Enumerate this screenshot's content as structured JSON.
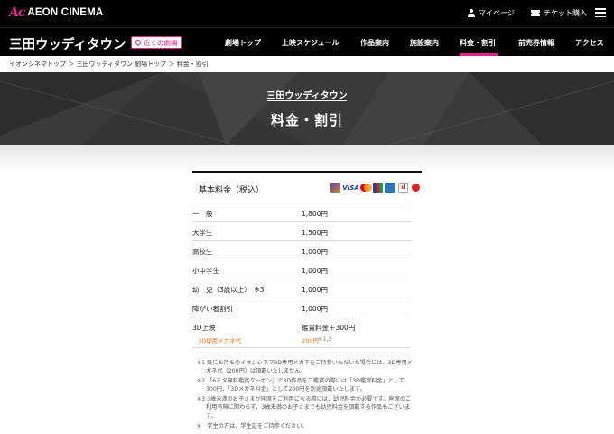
{
  "brand": {
    "mark": "Ac",
    "name": "AEON CINEMA"
  },
  "header": {
    "my_page": "マイページ",
    "ticket": "チケット購入"
  },
  "nav": {
    "theater_name": "三田ウッディタウン",
    "nearby_label": "近くの劇場",
    "items": [
      "劇場トップ",
      "上映スケジュール",
      "作品案内",
      "施設案内",
      "料金・割引",
      "前売券情報",
      "アクセス"
    ],
    "active_index": 4
  },
  "breadcrumb": "イオンシネマトップ ＞ 三田ウッディタウン 劇場トップ ＞ 料金・割引",
  "hero": {
    "subtitle": "三田ウッディタウン",
    "title": "料金・割引"
  },
  "pricing": {
    "heading": "基本料金（税込）",
    "payment_labels": {
      "visa": "VISA",
      "d": "d"
    },
    "rows": [
      {
        "category": "一　般",
        "price": "1,800円"
      },
      {
        "category": "大学生",
        "price": "1,500円"
      },
      {
        "category": "高校生",
        "price": "1,000円"
      },
      {
        "category": "小中学生",
        "price": "1,000円"
      },
      {
        "category": "幼　児（3歳以上）　※3",
        "price": "1,000円"
      },
      {
        "category": "障がい者割引",
        "price": "1,000円"
      }
    ],
    "three_d": {
      "category": "3D上映",
      "price": "鑑賞料金＋300円",
      "option_label": "3D専用メガネ代",
      "option_price": "200円",
      "option_ref": "※1,2"
    }
  },
  "notes": [
    "※1 既にお持ちのイオンシネマ3D専用メガネをご持参いただいた場合には、3D専用メガネ代（200円）は頂戴いたしません。",
    "※2 「6ミタ無料鑑賞クーポン」で3D作品をご鑑賞の際には「3D鑑賞料金」として300円、「3Dメガネ料金」として200円を別途頂戴いたします。",
    "※3 3歳未満のお子さまが座席をご利用になる際には、幼児料金が必要です。座席のご利用有無に関わらず、3歳未満のお子さまでも幼児料金を頂戴する作品もございます。",
    "※　学生の方は、学生証をご持参ください。"
  ],
  "colors": {
    "accent": "#e0238a",
    "option_orange": "#e8751a",
    "header_bg": "#000000"
  }
}
